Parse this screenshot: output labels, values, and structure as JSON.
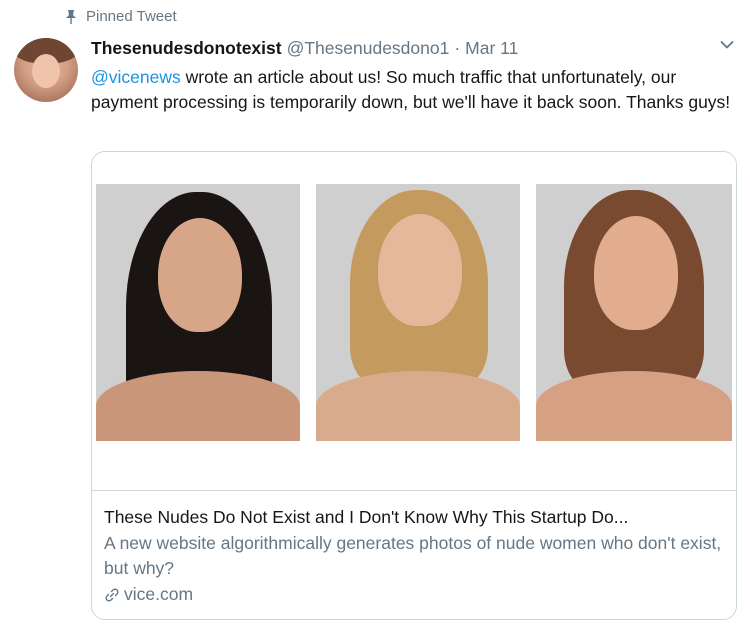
{
  "pinned": {
    "label": "Pinned Tweet",
    "icon": "pin-icon"
  },
  "author": {
    "display_name": "Thesenudesdonotexist",
    "handle": "@Thesenudesdono1",
    "separator": "·",
    "date": "Mar 11"
  },
  "tweet": {
    "mention": "@vicenews",
    "text": " wrote an article about us! So much traffic that unfortunately, our payment processing is temporarily down, but we'll have it back soon. Thanks guys!"
  },
  "card": {
    "title": "These Nudes Do Not Exist and I Don't Know Why This Startup Do...",
    "description": "A new website algorithmically generates photos of nude women who don't exist, but why?",
    "domain": "vice.com",
    "link_icon": "link-icon"
  },
  "colors": {
    "link_blue": "#1b95e0",
    "secondary_gray": "#657786",
    "border": "#ccd6dd"
  }
}
